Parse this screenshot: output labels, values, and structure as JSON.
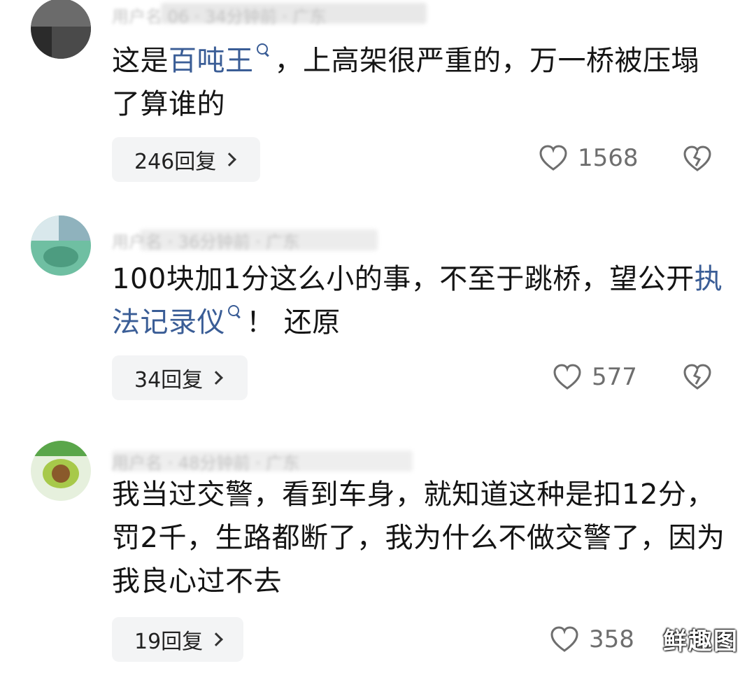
{
  "comments": [
    {
      "meta": "用户名 06 · 34分钟前 · 广东",
      "text_before": "这是",
      "link": "百吨王",
      "text_after": "，上高架很严重的，万一桥被压塌了算谁的",
      "replies": "246回复",
      "likes": "1568"
    },
    {
      "meta": "用户名 · 36分钟前 · 广东",
      "text_before": "100块加1分这么小的事，不至于跳桥，望公开",
      "link": "执法记录仪",
      "text_after": "！ 还原",
      "replies": "34回复",
      "likes": "577"
    },
    {
      "meta": "用户名 · 48分钟前 · 广东",
      "text_before": "我当过交警，看到车身，就知道这种是扣12分，罚2千，生路都断了，我为什么不做交警了，因为我良心过不去",
      "link": "",
      "text_after": "",
      "replies": "19回复",
      "likes": "358"
    }
  ],
  "watermark": "鲜趣图",
  "colors": {
    "link": "#3a5d96",
    "pill_bg": "#f3f4f5",
    "icon": "#6e6e6e"
  },
  "icons": [
    "search-icon",
    "heart-icon",
    "broken-heart-icon",
    "chevron-right-icon"
  ]
}
